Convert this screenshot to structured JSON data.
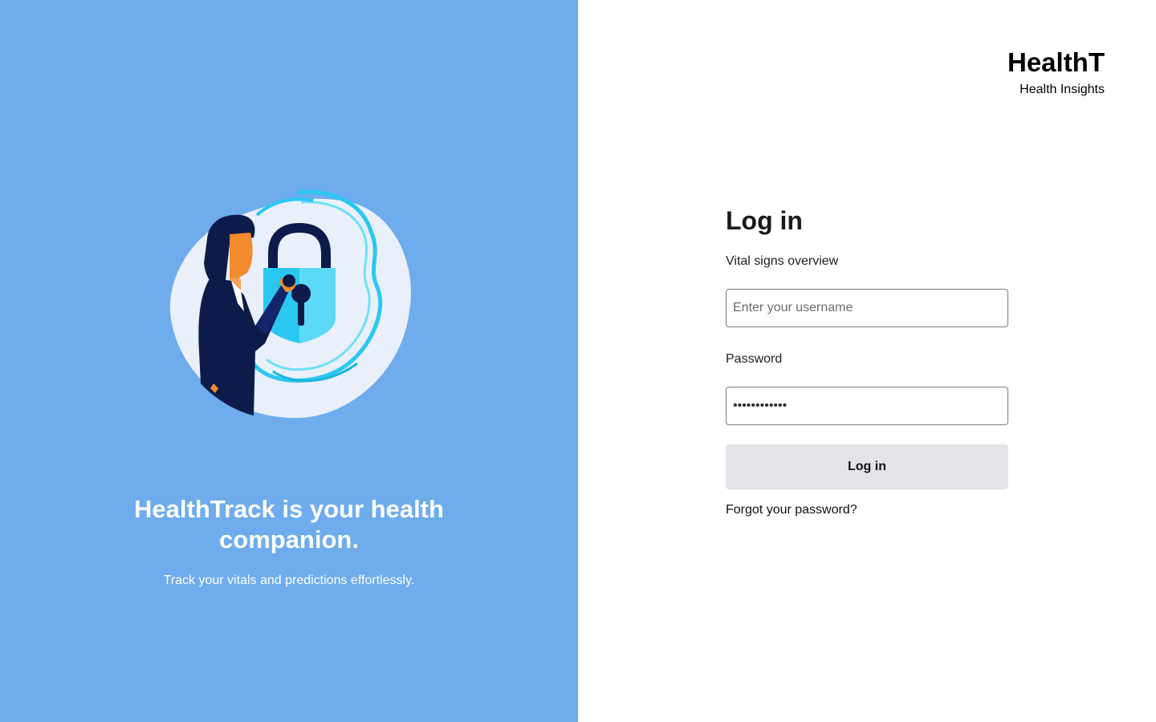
{
  "hero": {
    "illustration_icon": "person-unlocking-padlock-illustration",
    "headline": "HealthTrack is your health companion.",
    "subtext": "Track your vitals and predictions effortlessly."
  },
  "brand": {
    "name": "HealthT",
    "subtitle": "Health Insights"
  },
  "login": {
    "title": "Log in",
    "username_label": "Vital signs overview",
    "username_value": "",
    "username_placeholder": "Enter your username",
    "password_label": "Password",
    "password_value": "••••••••••••",
    "submit_label": "Log in",
    "forgot_link": "Forgot your password?"
  },
  "colors": {
    "hero_background": "#6eaced",
    "button_background": "#e3e4e8",
    "lock_accent": "#2ac8f0",
    "figure_skin": "#f28a2e",
    "figure_suit": "#0d1b4a"
  }
}
